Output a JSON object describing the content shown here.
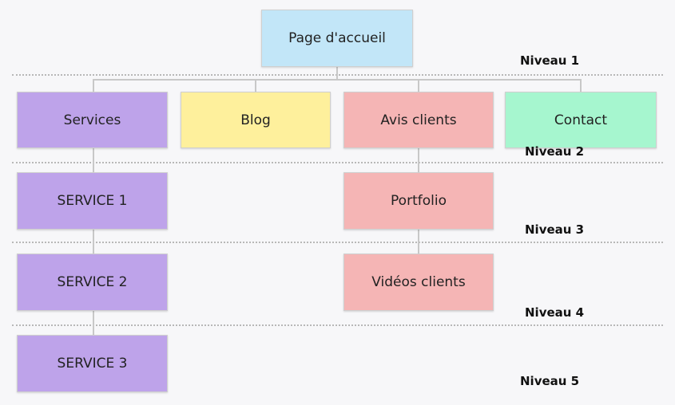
{
  "colors": {
    "home": "#c2e6f8",
    "services": "#bea3ea",
    "blog": "#fef09c",
    "avis": "#f5b5b5",
    "contact": "#a6f6cf"
  },
  "nodes": {
    "home": "Page d'accueil",
    "services": "Services",
    "blog": "Blog",
    "avis": "Avis clients",
    "contact": "Contact",
    "service1": "SERVICE 1",
    "service2": "SERVICE 2",
    "service3": "SERVICE 3",
    "portfolio": "Portfolio",
    "videos": "Vidéos clients"
  },
  "levels": [
    "Niveau 1",
    "Niveau 2",
    "Niveau 3",
    "Niveau 4",
    "Niveau 5"
  ]
}
